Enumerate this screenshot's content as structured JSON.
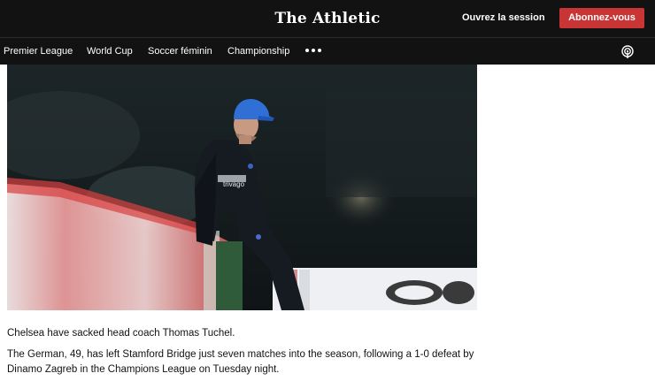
{
  "header": {
    "brand": "The Athletic",
    "login_label": "Ouvrez la session",
    "subscribe_label": "Abonnez-vous"
  },
  "nav": {
    "items": [
      "Premier League",
      "World Cup",
      "Soccer féminin",
      "Championship"
    ],
    "more_icon": "more-dots-icon",
    "podcast_icon": "podcast-icon"
  },
  "article": {
    "image_alt": "Thomas Tuchel sitting on advertising board at night stadium",
    "lead": "Chelsea have sacked head coach Thomas Tuchel.",
    "body": "The German, 49, has left Stamford Bridge just seven matches into the season, following a 1-0 defeat by Dinamo Zagreb in the Champions League on Tuesday night.",
    "shirt_text": "trivago"
  },
  "colors": {
    "header_bg": "#121212",
    "subscribe_bg": "#c93534",
    "cap_blue": "#2f6fd6"
  }
}
